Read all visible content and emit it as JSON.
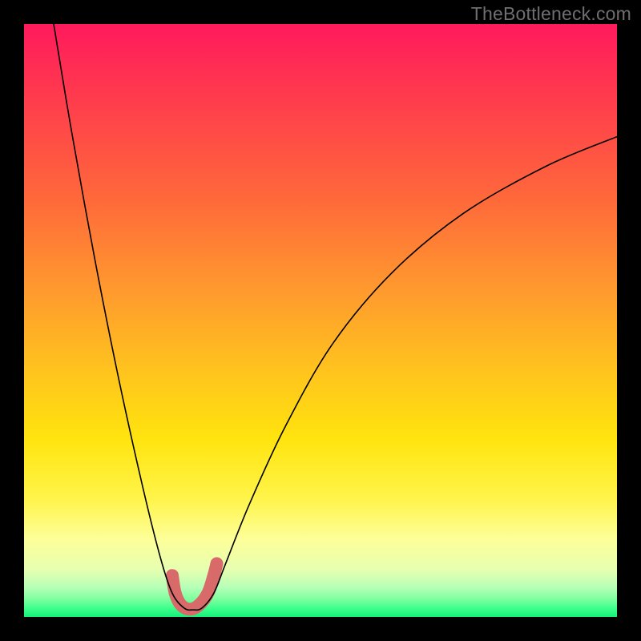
{
  "watermark": "TheBottleneck.com",
  "chart_data": {
    "type": "line",
    "title": "",
    "xlabel": "",
    "ylabel": "",
    "xlim": [
      0,
      100
    ],
    "ylim": [
      0,
      100
    ],
    "grid": false,
    "series": [
      {
        "name": "bottleneck-curve",
        "x": [
          5,
          8,
          12,
          16,
          20,
          23,
          25,
          27,
          28.5,
          30,
          32,
          34,
          38,
          44,
          52,
          62,
          74,
          88,
          100
        ],
        "y": [
          100,
          82,
          60,
          40,
          22,
          10,
          4,
          1.5,
          1.2,
          1.5,
          4,
          9,
          19,
          32,
          46,
          58,
          68,
          76,
          81
        ],
        "color": "#000000",
        "stroke_width": 1.6
      },
      {
        "name": "minimum-marker",
        "x": [
          25,
          25.5,
          26.5,
          28,
          29.5,
          31,
          32,
          32.5
        ],
        "y": [
          7,
          4,
          2,
          1.3,
          2,
          4,
          7,
          9
        ],
        "color": "#d86a6a",
        "stroke_width": 16
      }
    ],
    "annotations": []
  }
}
